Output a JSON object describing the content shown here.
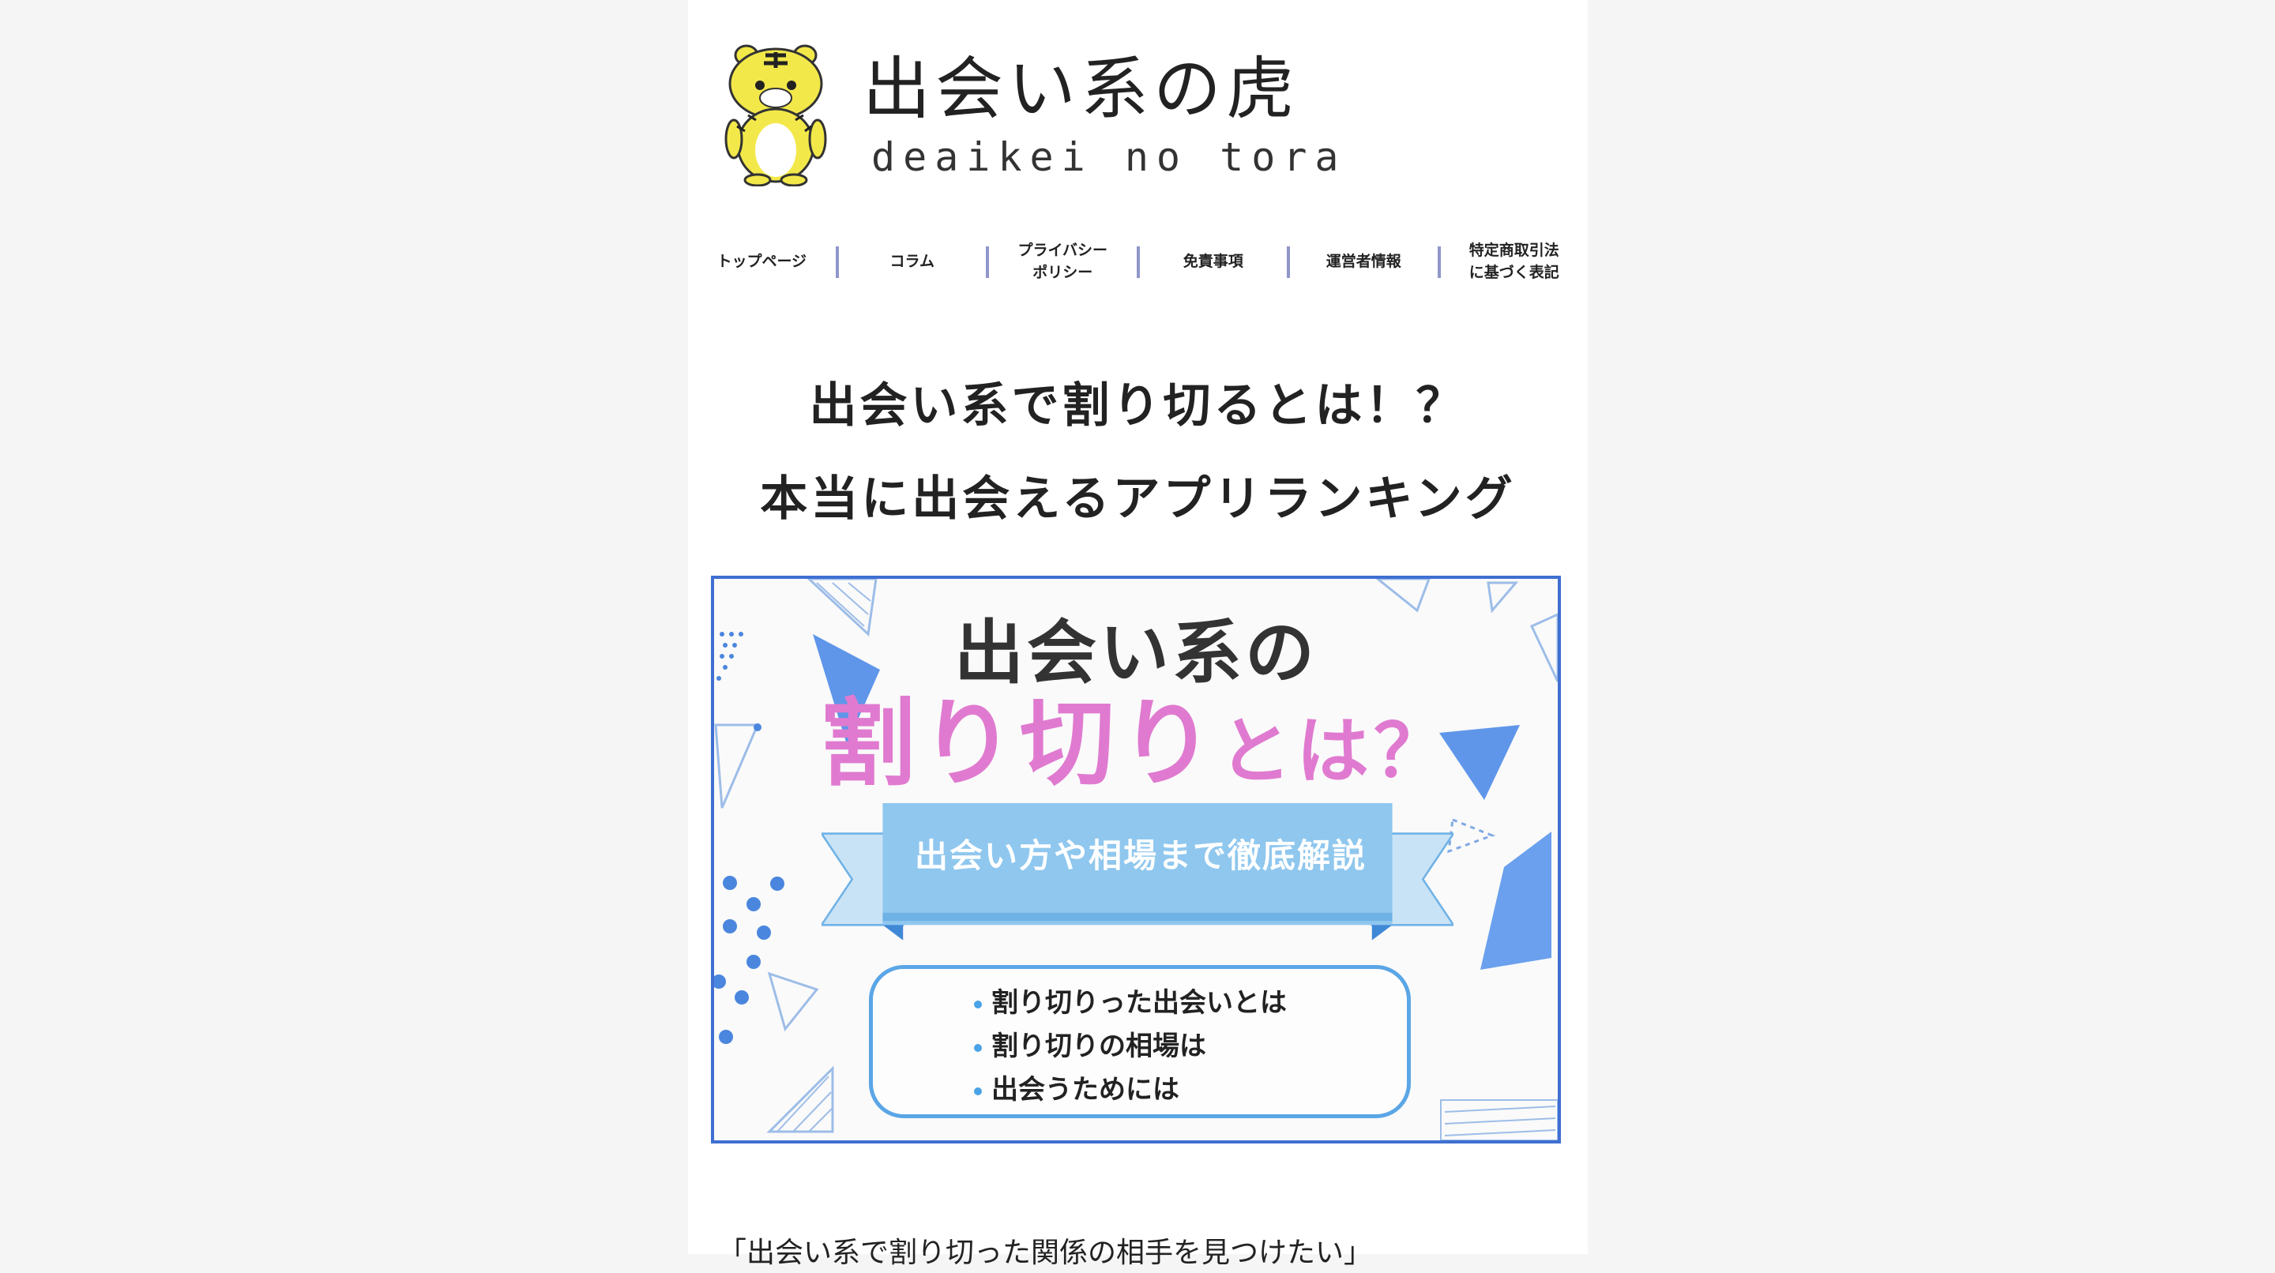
{
  "header": {
    "site_title": "出会い系の虎",
    "site_subtitle": "deaikei no tora"
  },
  "nav": {
    "items": [
      {
        "label": "トップページ"
      },
      {
        "label": "コラム"
      },
      {
        "label": "プライバシー\nポリシー"
      },
      {
        "label": "免責事項"
      },
      {
        "label": "運営者情報"
      },
      {
        "label": "特定商取引法\nに基づく表記"
      }
    ]
  },
  "article": {
    "title_line1": "出会い系で割り切るとは！？",
    "title_line2": "本当に出会えるアプリランキング",
    "intro_text": "「出会い系で割り切った関係の相手を見つけたい」"
  },
  "banner": {
    "line1": "出会い系の",
    "line2_main": "割り切り",
    "line2_small": "とは？",
    "ribbon_text": "出会い方や相場まで徹底解説",
    "points": [
      "割り切りった出会いとは",
      "割り切りの相場は",
      "出会うためには"
    ]
  },
  "colors": {
    "banner_border": "#3f6fd1",
    "accent_pink": "#e07ad0",
    "ribbon_blue": "#8fc7ee",
    "point_bullet": "#4aa3e6",
    "nav_separator": "#8f96c9"
  },
  "icons": {
    "logo": "tiger-mascot-icon"
  }
}
